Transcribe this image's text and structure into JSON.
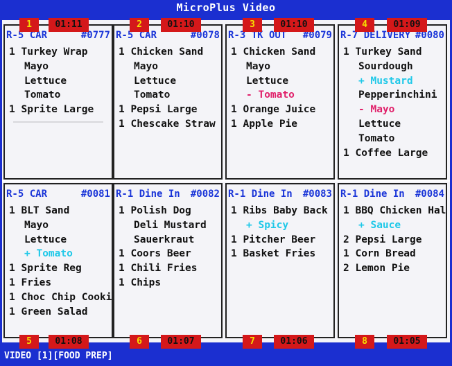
{
  "window": {
    "title": "MicroPlus Video"
  },
  "status_bar": {
    "text": "VIDEO [1][FOOD PREP]"
  },
  "tickets": [
    {
      "pos": "1",
      "timer": "01:11",
      "station": "R-5 CAR",
      "number": "#0777",
      "lines": [
        {
          "text": "1 Turkey Wrap",
          "type": "item"
        },
        {
          "text": "Mayo",
          "type": "mod"
        },
        {
          "text": "Lettuce",
          "type": "mod"
        },
        {
          "text": "Tomato",
          "type": "mod"
        },
        {
          "text": "1 Sprite Large",
          "type": "item"
        }
      ],
      "separator": true
    },
    {
      "pos": "2",
      "timer": "01:10",
      "station": "R-5 CAR",
      "number": "#0078",
      "lines": [
        {
          "text": "1 Chicken Sand",
          "type": "item"
        },
        {
          "text": "Mayo",
          "type": "mod"
        },
        {
          "text": "Lettuce",
          "type": "mod"
        },
        {
          "text": "Tomato",
          "type": "mod"
        },
        {
          "text": "1 Pepsi Large",
          "type": "item"
        },
        {
          "text": "1 Chescake Straw",
          "type": "item"
        }
      ]
    },
    {
      "pos": "3",
      "timer": "01:10",
      "station": "R-3 TK OUT",
      "number": "#0079",
      "lines": [
        {
          "text": "1 Chicken Sand",
          "type": "item"
        },
        {
          "text": "Mayo",
          "type": "mod"
        },
        {
          "text": "Lettuce",
          "type": "mod"
        },
        {
          "text": "- Tomato",
          "type": "rem"
        },
        {
          "text": "1 Orange Juice",
          "type": "item"
        },
        {
          "text": "1 Apple Pie",
          "type": "item"
        }
      ]
    },
    {
      "pos": "4",
      "timer": "01:09",
      "station": "R-7 DELIVERY",
      "number": "#0080",
      "lines": [
        {
          "text": "1 Turkey Sand",
          "type": "item"
        },
        {
          "text": "Sourdough",
          "type": "mod"
        },
        {
          "text": "+ Mustard",
          "type": "add"
        },
        {
          "text": "Pepperinchini",
          "type": "mod"
        },
        {
          "text": "- Mayo",
          "type": "rem"
        },
        {
          "text": "Lettuce",
          "type": "mod"
        },
        {
          "text": "Tomato",
          "type": "mod"
        },
        {
          "text": "1 Coffee Large",
          "type": "item"
        }
      ]
    },
    {
      "pos": "5",
      "timer": "01:08",
      "station": "R-5 CAR",
      "number": "#0081",
      "lines": [
        {
          "text": "1 BLT Sand",
          "type": "item"
        },
        {
          "text": "Mayo",
          "type": "mod"
        },
        {
          "text": "Lettuce",
          "type": "mod"
        },
        {
          "text": "+ Tomato",
          "type": "add"
        },
        {
          "text": "1 Sprite Reg",
          "type": "item"
        },
        {
          "text": "1 Fries",
          "type": "item"
        },
        {
          "text": "1 Choc Chip Cooki",
          "type": "item"
        },
        {
          "text": "1 Green Salad",
          "type": "item"
        }
      ]
    },
    {
      "pos": "6",
      "timer": "01:07",
      "station": "R-1 Dine In",
      "number": "#0082",
      "lines": [
        {
          "text": "1 Polish Dog",
          "type": "item"
        },
        {
          "text": "Deli Mustard",
          "type": "mod"
        },
        {
          "text": "Sauerkraut",
          "type": "mod"
        },
        {
          "text": "1 Coors Beer",
          "type": "item"
        },
        {
          "text": "1 Chili Fries",
          "type": "item"
        },
        {
          "text": "1 Chips",
          "type": "item"
        }
      ]
    },
    {
      "pos": "7",
      "timer": "01:06",
      "station": "R-1 Dine In",
      "number": "#0083",
      "lines": [
        {
          "text": "1 Ribs Baby Back",
          "type": "item"
        },
        {
          "text": "+ Spicy",
          "type": "add"
        },
        {
          "text": "1 Pitcher Beer",
          "type": "item"
        },
        {
          "text": "1 Basket Fries",
          "type": "item"
        }
      ]
    },
    {
      "pos": "8",
      "timer": "01:05",
      "station": "R-1 Dine In",
      "number": "#0084",
      "lines": [
        {
          "text": "1 BBQ Chicken Hal",
          "type": "item"
        },
        {
          "text": "+ Sauce",
          "type": "add"
        },
        {
          "text": "2 Pepsi Large",
          "type": "item"
        },
        {
          "text": "1 Corn Bread",
          "type": "item"
        },
        {
          "text": "2 Lemon Pie",
          "type": "item"
        }
      ]
    }
  ]
}
